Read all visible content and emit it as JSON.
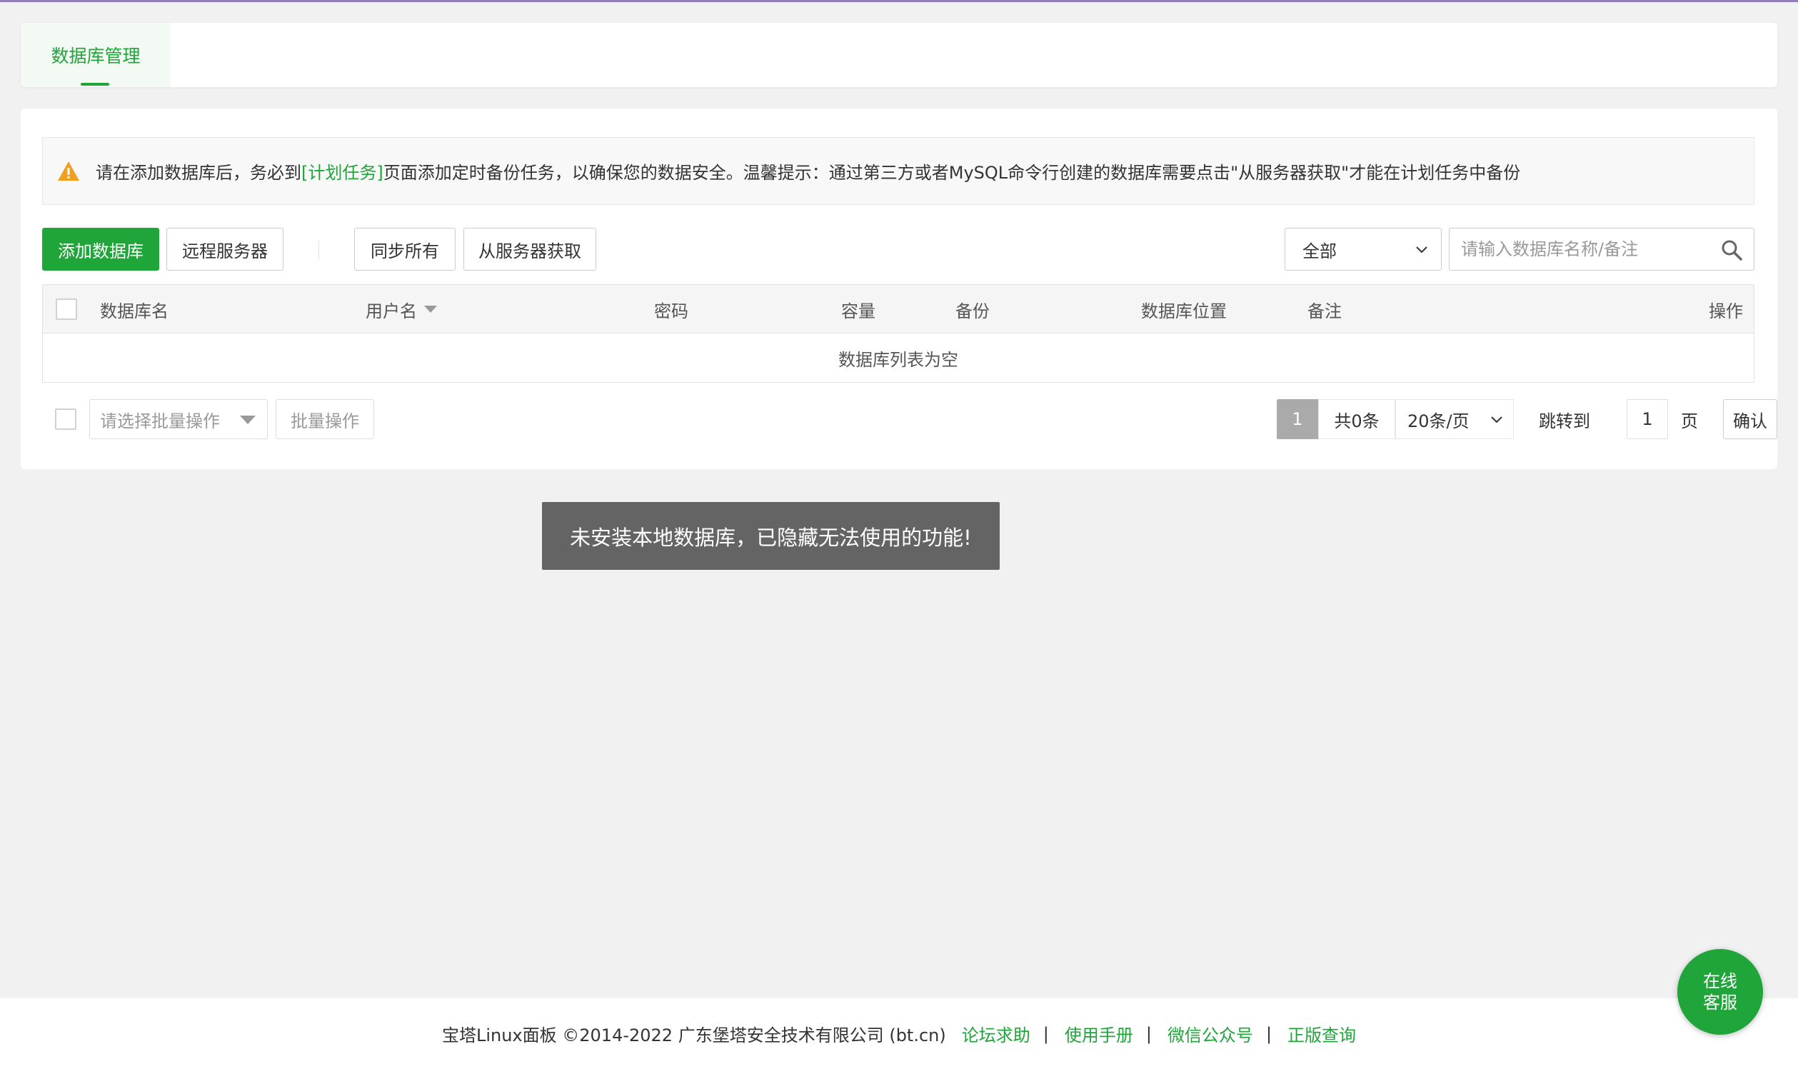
{
  "tabs": [
    {
      "label": "数据库管理",
      "active": true
    }
  ],
  "notice": {
    "text_before": "请在添加数据库后，务必到",
    "link": "[计划任务]",
    "text_after": "页面添加定时备份任务，以确保您的数据安全。温馨提示：通过第三方或者MySQL命令行创建的数据库需要点击\"从服务器获取\"才能在计划任务中备份"
  },
  "toolbar": {
    "add_db": "添加数据库",
    "remote_server": "远程服务器",
    "sync_all": "同步所有",
    "fetch_from_server": "从服务器获取",
    "filter_selected": "全部",
    "search_placeholder": "请输入数据库名称/备注"
  },
  "table": {
    "columns": [
      "数据库名",
      "用户名",
      "密码",
      "容量",
      "备份",
      "数据库位置",
      "备注",
      "操作"
    ],
    "empty_text": "数据库列表为空"
  },
  "batch": {
    "placeholder": "请选择批量操作",
    "button": "批量操作"
  },
  "pagination": {
    "current_page": "1",
    "total": "共0条",
    "page_size": "20条/页",
    "jump_label": "跳转到",
    "jump_value": "1",
    "page_unit": "页",
    "confirm": "确认"
  },
  "toast": "未安装本地数据库，已隐藏无法使用的功能!",
  "footer": {
    "copyright": "宝塔Linux面板 ©2014-2022 广东堡塔安全技术有限公司 (bt.cn)",
    "links": [
      "论坛求助",
      "使用手册",
      "微信公众号",
      "正版查询"
    ],
    "separator": "|"
  },
  "help": {
    "line1": "在线",
    "line2": "客服"
  },
  "colors": {
    "accent": "#20a53a",
    "warning": "#f0a020",
    "toast_bg": "#646464"
  }
}
